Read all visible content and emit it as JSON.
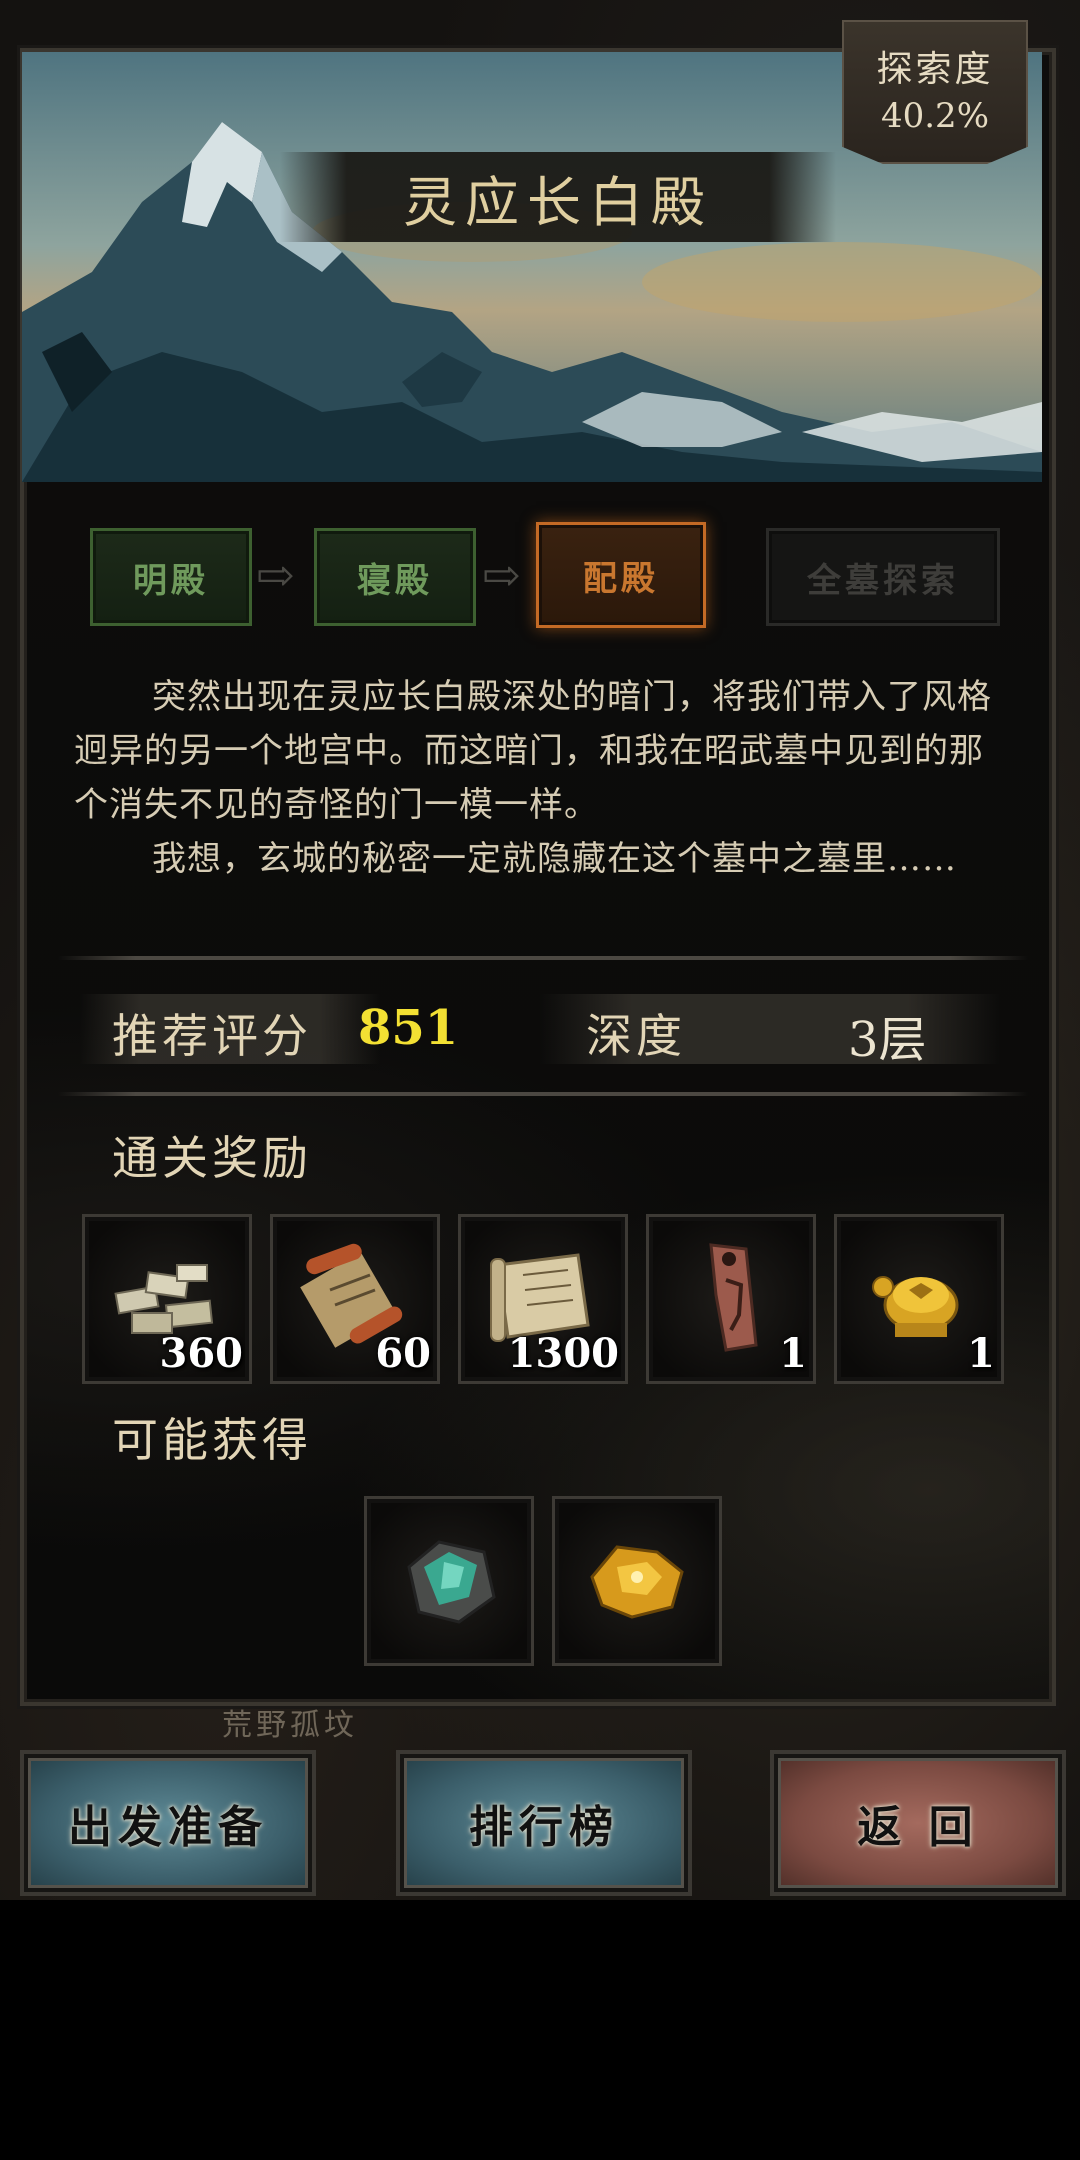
{
  "map": {
    "location_label": "荒野孤坟"
  },
  "header": {
    "title": "灵应长白殿",
    "explore_label": "探索度",
    "explore_value": "40.2%"
  },
  "stages": [
    {
      "label": "明殿",
      "state": "done"
    },
    {
      "label": "寝殿",
      "state": "done"
    },
    {
      "label": "配殿",
      "state": "active"
    },
    {
      "label": "全墓探索",
      "state": "locked"
    }
  ],
  "description": {
    "line1": "突然出现在灵应长白殿深处的暗门，将我们带入了风格迥异的另一个地宫中。而这暗门，和我在昭武墓中见到的那个消失不见的奇怪的门一模一样。",
    "line2": "我想，玄城的秘密一定就隐藏在这个墓中之墓里……"
  },
  "stats": {
    "score_label": "推荐评分",
    "score_value": "851",
    "depth_label": "深度",
    "depth_value": "3层"
  },
  "rewards": {
    "title": "通关奖励",
    "items": [
      {
        "icon": "silver-ingots-icon",
        "count": "360"
      },
      {
        "icon": "scroll-icon",
        "count": "60"
      },
      {
        "icon": "map-scroll-icon",
        "count": "1300"
      },
      {
        "icon": "bronze-token-icon",
        "count": "1"
      },
      {
        "icon": "golden-turtle-icon",
        "count": "1"
      }
    ]
  },
  "possible": {
    "title": "可能获得",
    "items": [
      {
        "icon": "jade-ore-icon"
      },
      {
        "icon": "gold-nugget-icon"
      }
    ]
  },
  "buttons": {
    "prepare": "出发准备",
    "ranking": "排行榜",
    "back": "返 回"
  },
  "colors": {
    "score": "#f3e033",
    "stage_done": "#6f9a5c",
    "stage_active": "#c9772f",
    "button_blue": "#3b5e6a",
    "button_red": "#7b4a41"
  }
}
